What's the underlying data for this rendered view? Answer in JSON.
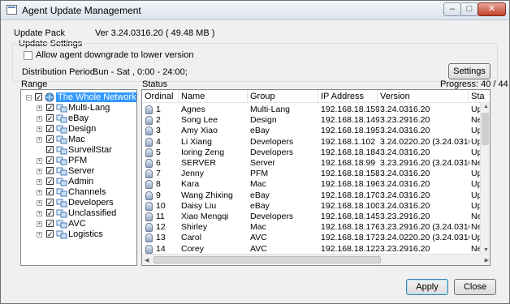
{
  "window": {
    "title": "Agent Update Management"
  },
  "update_pack": {
    "label": "Update Pack",
    "version": "Ver 3.24.0316.20 ( 49.48 MB )"
  },
  "update_settings": {
    "group_label": "Update Settings",
    "allow_downgrade_label": "Allow agent downgrade to lower version",
    "allow_downgrade_checked": false,
    "distribution_label": "Distribution Period:",
    "distribution_value": "Sun - Sat , 0:00 - 24:00;",
    "settings_button": "Settings"
  },
  "range": {
    "label": "Range",
    "root": "The Whole Network",
    "items": [
      "Multi-Lang",
      "eBay",
      "Design",
      "Mac",
      "SurveilStar",
      "PFM",
      "Server",
      "Admin",
      "Channels",
      "Developers",
      "Unclassified",
      "AVC",
      "Logistics"
    ]
  },
  "status": {
    "label": "Status",
    "progress": "Progress: 40 / 44",
    "columns": [
      "Ordinal",
      "Name",
      "Group",
      "IP Address",
      "Version",
      "Sta"
    ],
    "rows": [
      [
        "1",
        "Agnes",
        "Multi-Lang",
        "192.168.18.159",
        "3.24.0316.20",
        "Up"
      ],
      [
        "2",
        "Song Lee",
        "Design",
        "192.168.18.149",
        "3.23.2916.20",
        "Ne"
      ],
      [
        "3",
        "Amy Xiao",
        "eBay",
        "192.168.18.195",
        "3.24.0316.20",
        "Up"
      ],
      [
        "4",
        "Li Xiang",
        "Developers",
        "192.168.1.102",
        "3.24.0220.20 (3.24.0316.20)",
        "Up"
      ],
      [
        "5",
        "Ioring Zeng",
        "Developers",
        "192.168.18.184",
        "3.24.0316.20",
        "Up"
      ],
      [
        "6",
        "SERVER",
        "Server",
        "192.168.18.99",
        "3.23.2916.20 (3.24.0316.20)",
        "Ne"
      ],
      [
        "7",
        "Jenny",
        "PFM",
        "192.168.18.158",
        "3.24.0316.20",
        "Up"
      ],
      [
        "8",
        "Kara",
        "Mac",
        "192.168.18.196",
        "3.24.0316.20",
        "Up"
      ],
      [
        "9",
        "Wang Zhixing",
        "eBay",
        "192.168.18.170",
        "3.24.0316.20",
        "Up"
      ],
      [
        "10",
        "Daisy Liu",
        "eBay",
        "192.168.18.100",
        "3.24.0316.20",
        "Up"
      ],
      [
        "11",
        "Xiao Mengqi",
        "Developers",
        "192.168.18.145",
        "3.23.2916.20",
        "Ne"
      ],
      [
        "12",
        "Shirley",
        "Mac",
        "192.168.18.176",
        "3.23.2916.20 (3.24.0316.20)",
        "Ne"
      ],
      [
        "13",
        "Carol",
        "AVC",
        "192.168.18.172",
        "3.24.0220.20 (3.24.0316.20)",
        "Up"
      ],
      [
        "14",
        "Corey",
        "AVC",
        "192.168.18.122",
        "3.23.2916.20",
        "Ne"
      ]
    ]
  },
  "footer": {
    "apply": "Apply",
    "close": "Close"
  }
}
